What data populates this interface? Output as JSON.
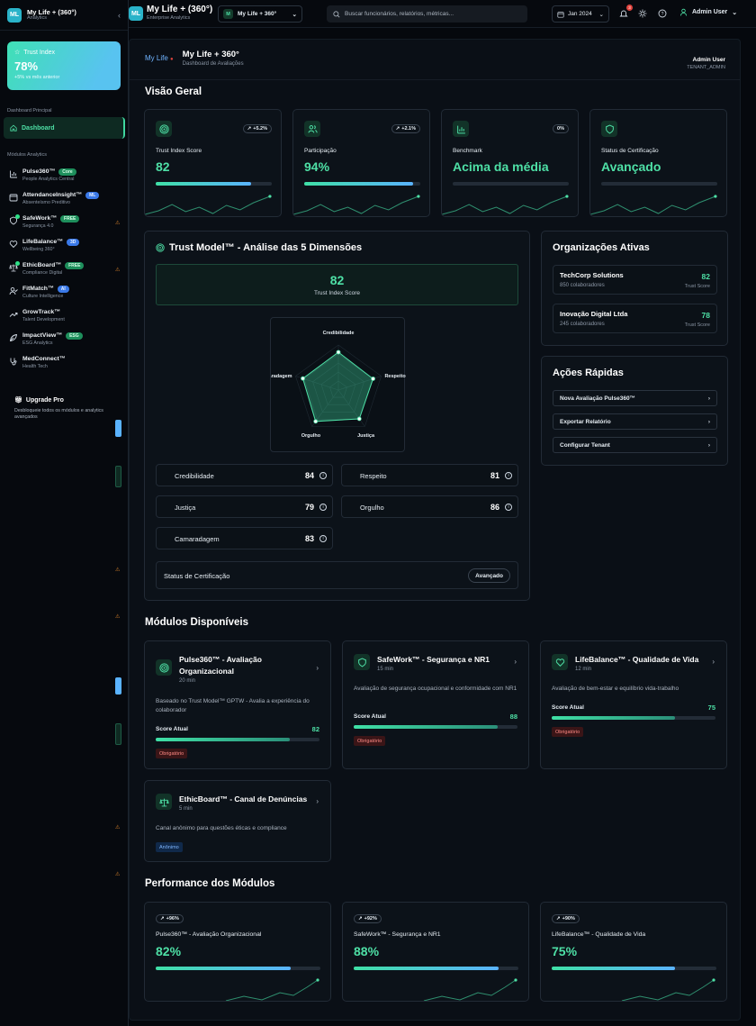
{
  "sidebar": {
    "logo": "ML",
    "title": "My Life + (360°)",
    "subtitle": "Analytics",
    "trust_index": {
      "label": "Trust Index",
      "value": "78%",
      "delta": "+5% vs mês anterior"
    },
    "section_main": "Dashboard Principal",
    "dashboard_label": "Dashboard",
    "section_modules": "Módulos Analytics",
    "modules": [
      {
        "name": "Pulse360™",
        "badge": "Core",
        "sub": "People Analytics Central",
        "icon": "bar-chart-icon"
      },
      {
        "name": "AttendanceInsight™",
        "badge": "ML",
        "sub": "Absenteísmo Preditivo",
        "icon": "calendar-icon"
      },
      {
        "name": "SafeWork™",
        "badge": "FREE",
        "sub": "Segurança 4.0",
        "icon": "shield-icon"
      },
      {
        "name": "LifeBalance™",
        "badge": "3D",
        "sub": "Wellbeing 360°",
        "icon": "heart-icon"
      },
      {
        "name": "EthicBoard™",
        "badge": "FREE",
        "sub": "Compliance Digital",
        "icon": "scale-icon"
      },
      {
        "name": "FitMatch™",
        "badge": "AI",
        "sub": "Culture Intelligence",
        "icon": "user-check-icon"
      },
      {
        "name": "GrowTrack™",
        "badge": "",
        "sub": "Talent Development",
        "icon": "trending-up-icon"
      },
      {
        "name": "ImpactView™",
        "badge": "ESG",
        "sub": "ESG Analytics",
        "icon": "leaf-icon"
      },
      {
        "name": "MedConnect™",
        "badge": "",
        "sub": "Health Tech",
        "icon": "stethoscope-icon"
      }
    ],
    "upgrade": {
      "title": "Upgrade Pro",
      "desc": "Desbloqueie todos os módulos e analytics avançados"
    }
  },
  "topbar": {
    "title": "My Life + (360°)",
    "subtitle": "Enterprise Analytics",
    "selector": {
      "letter": "M",
      "label": "My Life + 360°"
    },
    "search_placeholder": "Buscar funcionários, relatórios, métricas...",
    "date": "Jan 2024",
    "notifications": "3",
    "user": "Admin User"
  },
  "page": {
    "brand": "My Life",
    "title": "My Life + 360°",
    "subtitle": "Dashboard de Avaliações",
    "user_name": "Admin User",
    "user_role": "TENANT_ADMIN"
  },
  "overview": {
    "title": "Visão Geral",
    "kpis": [
      {
        "label": "Trust Index Score",
        "value": "82",
        "change": "+5.2%",
        "trend": "up",
        "progress": 0.82,
        "color": "#4ee0a6"
      },
      {
        "label": "Participação",
        "value": "94%",
        "change": "+2.1%",
        "trend": "up",
        "progress": 0.94,
        "color": "#4ee0a6"
      },
      {
        "label": "Benchmark",
        "value": "Acima da média",
        "change": "0%",
        "trend": "flat",
        "progress": 0,
        "color": "#4ee0a6"
      },
      {
        "label": "Status de Certificação",
        "value": "Avançado",
        "change": "",
        "trend": "none",
        "progress": 0,
        "color": "#4ee0a6"
      }
    ]
  },
  "trust_model": {
    "title": "Trust Model™ - Análise das 5 Dimensões",
    "score": "82",
    "score_label": "Trust Index Score",
    "dimensions": [
      {
        "name": "Credibilidade",
        "value": 84
      },
      {
        "name": "Respeito",
        "value": 81
      },
      {
        "name": "Justiça",
        "value": 79
      },
      {
        "name": "Orgulho",
        "value": 86
      },
      {
        "name": "Camaradagem",
        "value": 83
      }
    ],
    "cert_label": "Status de Certificação",
    "cert_value": "Avançado"
  },
  "orgs": {
    "title": "Organizações Ativas",
    "items": [
      {
        "name": "TechCorp Solutions",
        "count": "850 colaboradores",
        "score": "82",
        "score_label": "Trust Score"
      },
      {
        "name": "Inovação Digital Ltda",
        "count": "245 colaboradores",
        "score": "78",
        "score_label": "Trust Score"
      }
    ]
  },
  "quick_actions": {
    "title": "Ações Rápidas",
    "items": [
      "Nova Avaliação Pulse360™",
      "Exportar Relatório",
      "Configurar Tenant"
    ]
  },
  "modules_available": {
    "title": "Módulos Disponíveis",
    "items": [
      {
        "title": "Pulse360™ - Avaliação Organizacional",
        "minutes": "20 min",
        "desc": "Baseado no Trust Model™ GPTW - Avalia a experiência do colaborador",
        "score_label": "Score Atual",
        "score": "82",
        "progress": 0.82,
        "tag": "Obrigatório",
        "icon": "target-icon"
      },
      {
        "title": "SafeWork™ - Segurança e NR1",
        "minutes": "15 min",
        "desc": "Avaliação de segurança ocupacional e conformidade com NR1",
        "score_label": "Score Atual",
        "score": "88",
        "progress": 0.88,
        "tag": "Obrigatório",
        "icon": "shield-icon"
      },
      {
        "title": "LifeBalance™ - Qualidade de Vida",
        "minutes": "12 min",
        "desc": "Avaliação de bem-estar e equilíbrio vida-trabalho",
        "score_label": "Score Atual",
        "score": "75",
        "progress": 0.75,
        "tag": "Obrigatório",
        "icon": "heart-icon"
      },
      {
        "title": "EthicBoard™ - Canal de Denúncias",
        "minutes": "5 min",
        "desc": "Canal anônimo para questões éticas e compliance",
        "tag": "Anônimo",
        "icon": "scale-icon"
      }
    ]
  },
  "performance": {
    "title": "Performance dos Módulos",
    "items": [
      {
        "change": "+96%",
        "label": "Pulse360™ - Avaliação Organizacional",
        "value": "82%",
        "progress": 0.82
      },
      {
        "change": "+92%",
        "label": "SafeWork™ - Segurança e NR1",
        "value": "88%",
        "progress": 0.88
      },
      {
        "change": "+90%",
        "label": "LifeBalance™ - Qualidade de Vida",
        "value": "75%",
        "progress": 0.75
      }
    ]
  }
}
